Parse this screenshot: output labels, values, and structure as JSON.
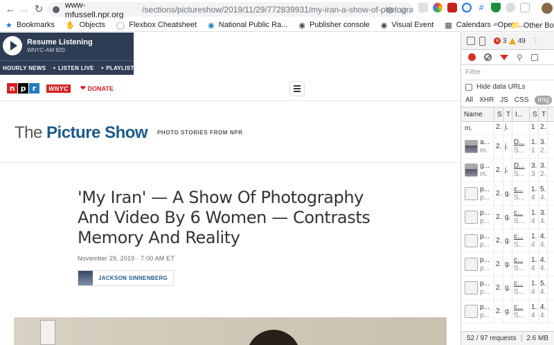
{
  "browser": {
    "url_host": "www-mfussell.npr.org",
    "url_path": "/sections/pictureshow/2019/11/29/772839931/my-iran-a-show-of-photogra..."
  },
  "bookmarks": {
    "items": [
      {
        "label": "Bookmarks",
        "icon": "star-icon"
      },
      {
        "label": "Objects",
        "icon": "hand-icon"
      },
      {
        "label": "Flexbox Cheatsheet",
        "icon": "loading-circle-icon"
      },
      {
        "label": "National Public Ra...",
        "icon": "npr-circle-icon"
      },
      {
        "label": "Publisher console",
        "icon": "globe-icon"
      },
      {
        "label": "Visual Event",
        "icon": "globe-icon"
      },
      {
        "label": "Calendars - Opera...",
        "icon": "calendar-icon"
      }
    ],
    "more": "»",
    "other": "Other Bookm"
  },
  "player": {
    "title": "Resume Listening",
    "station": "WNYC-AM 820",
    "links": [
      "HOURLY NEWS",
      "‣ LISTEN LIVE",
      "‣ PLAYLIST"
    ]
  },
  "header": {
    "logo_letters": [
      "n",
      "p",
      "r"
    ],
    "station_logo": "WNYC",
    "donate": "DONATE"
  },
  "section": {
    "prefix": "The ",
    "name": "Picture Show",
    "tagline": "PHOTO STORIES FROM NPR"
  },
  "article": {
    "title": "'My Iran' — A Show Of Photography And Video By 6 Women — Contrasts Memory And Reality",
    "date": "November 29, 2019 · 7:00 AM ET",
    "author": "JACKSON SINNENBERG"
  },
  "devtools": {
    "error_count": "3",
    "warning_count": "49",
    "filter_placeholder": "Filter",
    "hide_data_urls": "Hide data URLs",
    "types": [
      "All",
      "XHR",
      "JS",
      "CSS",
      "Img"
    ],
    "selected_type": "Img",
    "columns": [
      "Name",
      "S",
      "T",
      "I...",
      "S",
      "T"
    ],
    "rows": [
      {
        "name": "m.",
        "name2": "",
        "s": "2.",
        "t": "j.",
        "i": "",
        "s2": "1",
        "t2": "2."
      },
      {
        "name": "a...",
        "name2": "m.",
        "s": "2.",
        "t": "j.",
        "i": "D...",
        "i2": "S...",
        "s2": "1.",
        "s3": "1",
        "t2": "3.",
        "t3": "2."
      },
      {
        "name": "g...",
        "name2": "m.",
        "s": "2.",
        "t": "j.",
        "i": "D...",
        "i2": "S...",
        "s2": "3.",
        "s3": "3",
        "t2": "3.",
        "t3": "2."
      },
      {
        "name": "p...",
        "name2": "p...",
        "s": "2.",
        "t": "g.",
        "i": "c...",
        "i2": "S...",
        "s2": "1.",
        "s3": "4",
        "t2": "5.",
        "t3": "4."
      },
      {
        "name": "p...",
        "name2": "p...",
        "s": "2.",
        "t": "g.",
        "i": "c...",
        "i2": "S...",
        "s2": "1.",
        "s3": "4",
        "t2": "3.",
        "t3": "4."
      },
      {
        "name": "p...",
        "name2": "p...",
        "s": "2.",
        "t": "g.",
        "i": "c...",
        "i2": "S...",
        "s2": "1.",
        "s3": "4",
        "t2": "4.",
        "t3": "4."
      },
      {
        "name": "p...",
        "name2": "p...",
        "s": "2.",
        "t": "g.",
        "i": "c...",
        "i2": "S...",
        "s2": "1.",
        "s3": "4",
        "t2": "4.",
        "t3": "4."
      },
      {
        "name": "p...",
        "name2": "p...",
        "s": "2.",
        "t": "g.",
        "i": "c...",
        "i2": "S...",
        "s2": "1.",
        "s3": "4",
        "t2": "5.",
        "t3": "4."
      },
      {
        "name": "p...",
        "name2": "p...",
        "s": "2.",
        "t": "g.",
        "i": "c...",
        "i2": "S...",
        "s2": "1.",
        "s3": "4",
        "t2": "4.",
        "t3": "4."
      }
    ],
    "status_requests": "52 / 97 requests",
    "status_size": "2.6 MB"
  },
  "colors": {
    "player_bg": "#2e3c54",
    "npr_red": "#d62021",
    "npr_blue": "#237bbd",
    "section_blue": "#1d5a8a",
    "devtools_error": "#d93025"
  }
}
